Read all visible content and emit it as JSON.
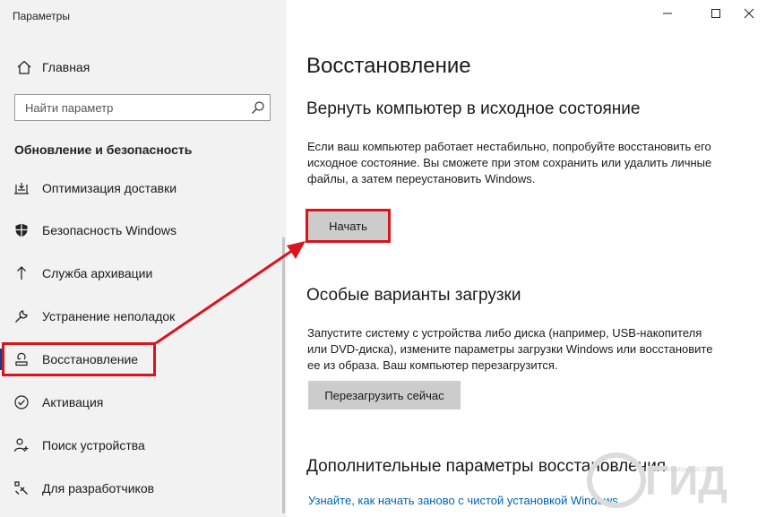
{
  "window": {
    "title": "Параметры",
    "minimize_icon": "minimize-icon",
    "maximize_icon": "maximize-icon",
    "close_icon": "close-icon"
  },
  "sidebar": {
    "home": {
      "label": "Главная",
      "icon": "home-icon"
    },
    "search": {
      "placeholder": "Найти параметр",
      "value": "",
      "icon": "search-icon"
    },
    "section_title": "Обновление и безопасность",
    "items": [
      {
        "label": "Оптимизация доставки",
        "icon": "delivery-optimization-icon",
        "active": false
      },
      {
        "label": "Безопасность Windows",
        "icon": "shield-icon",
        "active": false
      },
      {
        "label": "Служба архивации",
        "icon": "backup-arrow-icon",
        "active": false
      },
      {
        "label": "Устранение неполадок",
        "icon": "wrench-icon",
        "active": false
      },
      {
        "label": "Восстановление",
        "icon": "recovery-icon",
        "active": true
      },
      {
        "label": "Активация",
        "icon": "check-circle-icon",
        "active": false
      },
      {
        "label": "Поиск устройства",
        "icon": "person-location-icon",
        "active": false
      },
      {
        "label": "Для разработчиков",
        "icon": "developer-tools-icon",
        "active": false
      }
    ]
  },
  "main": {
    "title": "Восстановление",
    "reset": {
      "heading": "Вернуть компьютер в исходное состояние",
      "text": "Если ваш компьютер работает нестабильно, попробуйте восстановить его исходное состояние. Вы сможете при этом сохранить или удалить личные файлы, а затем переустановить Windows.",
      "button": "Начать"
    },
    "advanced_startup": {
      "heading": "Особые варианты загрузки",
      "text": "Запустите систему с устройства либо диска (например, USB-накопителя или DVD-диска), измените параметры загрузки Windows или восстановите ее из образа. Ваш компьютер перезагрузится.",
      "button": "Перезагрузить сейчас"
    },
    "more_options": {
      "heading": "Дополнительные параметры восстановления",
      "link": "Узнайте, как начать заново с чистой установкой Windows"
    }
  },
  "annotations": {
    "highlight_color": "#d9141b"
  },
  "watermark": {
    "text": "ГИД",
    "tagline": "ИНФОРМАЦИОННАЯ СЕТЬ"
  },
  "colors": {
    "sidebar_bg": "#f2f2f2",
    "button_bg": "#cccccc",
    "link": "#0063b1",
    "accent": "#1a3a8a"
  }
}
